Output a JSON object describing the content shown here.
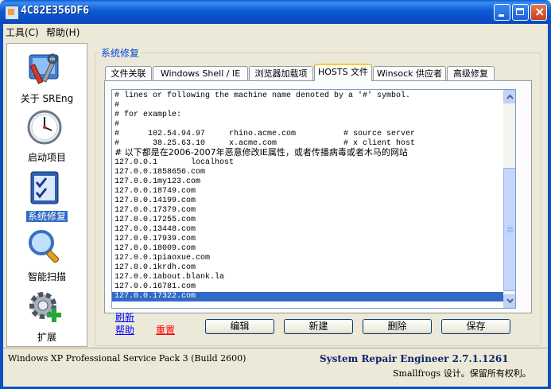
{
  "window": {
    "title": "4C82E356DF6"
  },
  "menu": {
    "items": [
      "工具(C)",
      "帮助(H)"
    ]
  },
  "nav": {
    "items": [
      {
        "label": "关于 SREng",
        "icon": "about-tools-icon"
      },
      {
        "label": "启动项目",
        "icon": "clock-icon"
      },
      {
        "label": "系统修复",
        "icon": "checklist-icon",
        "selected": true
      },
      {
        "label": "智能扫描",
        "icon": "magnifier-icon"
      },
      {
        "label": "扩展",
        "icon": "gear-plus-icon"
      }
    ]
  },
  "group": {
    "title": "系统修复"
  },
  "tabs": [
    "文件关联",
    "Windows Shell / IE",
    "浏览器加载项",
    "HOSTS 文件",
    "Winsock 供应者",
    "高级修复"
  ],
  "active_tab": "HOSTS 文件",
  "hosts": {
    "lines": [
      "# lines or following the machine name denoted by a '#' symbol.",
      "#",
      "# for example:",
      "#",
      "#      102.54.94.97     rhino.acme.com          # source server",
      "#       38.25.63.10     x.acme.com              # x client host",
      "# 以下都是在2006-2007年恶意修改IE属性，或者传播病毒或者木马的网站",
      "127.0.0.1       localhost",
      "127.0.0.1858656.com",
      "127.0.0.1my123.com",
      "127.0.0.18749.com",
      "127.0.0.14199.com",
      "127.0.0.17379.com",
      "127.0.0.17255.com",
      "127.0.0.13448.com",
      "127.0.0.17939.com",
      "127.0.0.18009.com",
      "127.0.0.1piaoxue.com",
      "127.0.0.1krdh.com",
      "127.0.0.1about.blank.la",
      "127.0.0.16781.com",
      "127.0.0.17322.com"
    ],
    "selected_line": "127.0.0.17322.com"
  },
  "links": {
    "refresh": "刷新",
    "help": "帮助",
    "reset": "重置"
  },
  "buttons": {
    "edit": "编辑",
    "new": "新建",
    "delete": "删除",
    "save": "保存"
  },
  "status": {
    "os": "Windows XP Professional Service Pack 3 (Build 2600)",
    "product": "System Repair Engineer 2.7.1.1261",
    "copyright": "Smallfrogs 设计。保留所有权利。"
  }
}
